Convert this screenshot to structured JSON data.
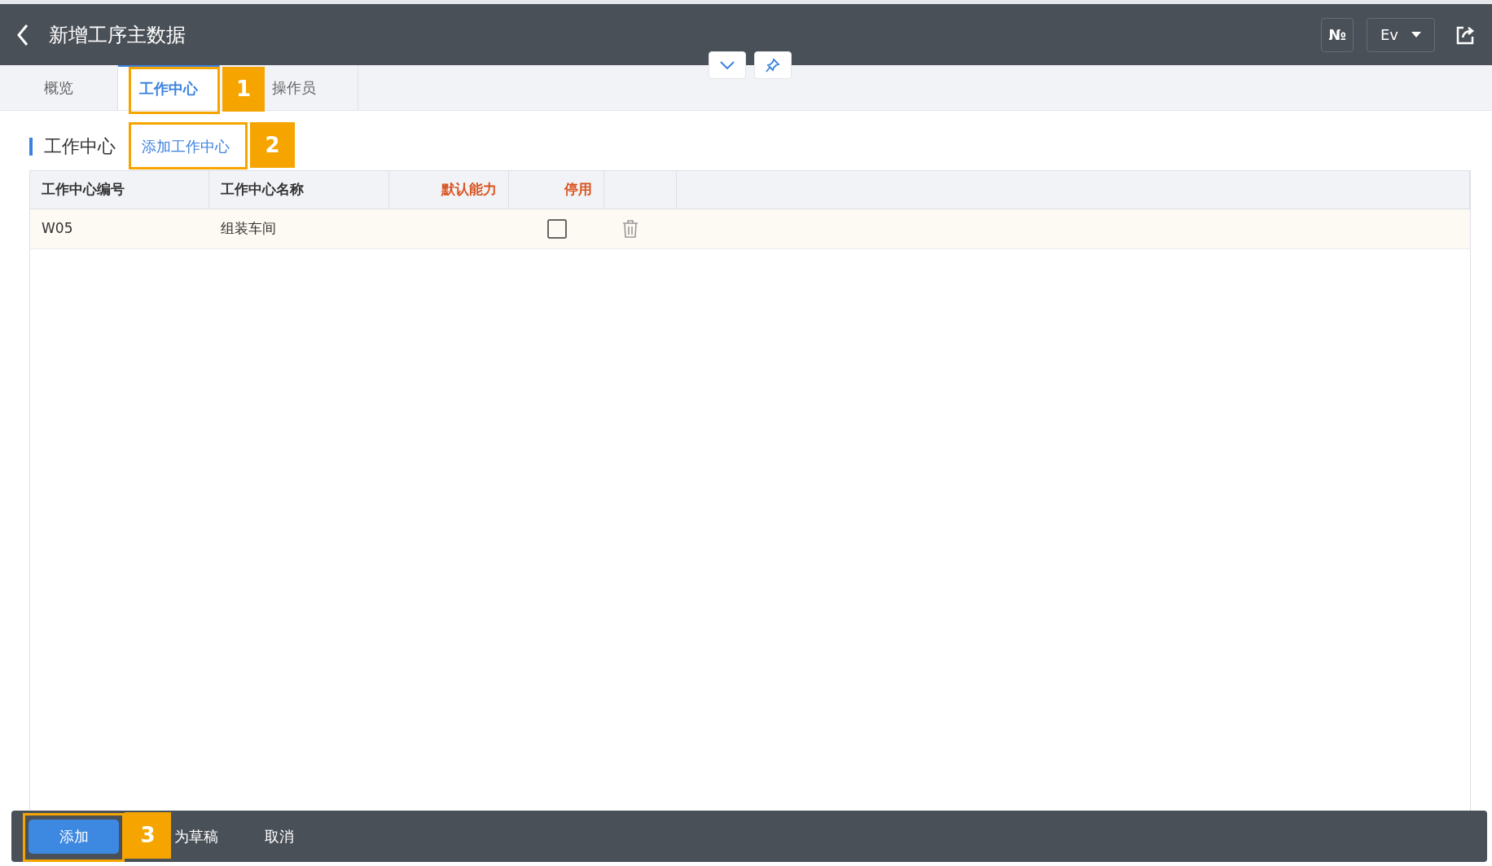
{
  "header": {
    "title": "新增工序主数据",
    "number_button": "№",
    "language": "Ev"
  },
  "tabs": [
    {
      "label": "概览",
      "selected": false
    },
    {
      "label": "工作中心",
      "selected": true
    },
    {
      "label": "操作员",
      "selected": false
    }
  ],
  "section": {
    "title": "工作中心",
    "add_link": "添加工作中心"
  },
  "table": {
    "columns": [
      {
        "label": "工作中心编号",
        "required": false
      },
      {
        "label": "工作中心名称",
        "required": false
      },
      {
        "label": "默认能力",
        "required": true
      },
      {
        "label": "停用",
        "required": true
      }
    ],
    "rows": [
      {
        "code": "W05",
        "name": "组装车间",
        "disabled": false
      }
    ]
  },
  "footer": {
    "buttons": [
      {
        "label": "添加",
        "kind": "primary"
      },
      {
        "label": "为草稿",
        "kind": "plain"
      },
      {
        "label": "取消",
        "kind": "plain"
      }
    ]
  },
  "annotations": [
    {
      "number": "1"
    },
    {
      "number": "2"
    },
    {
      "number": "3"
    }
  ]
}
